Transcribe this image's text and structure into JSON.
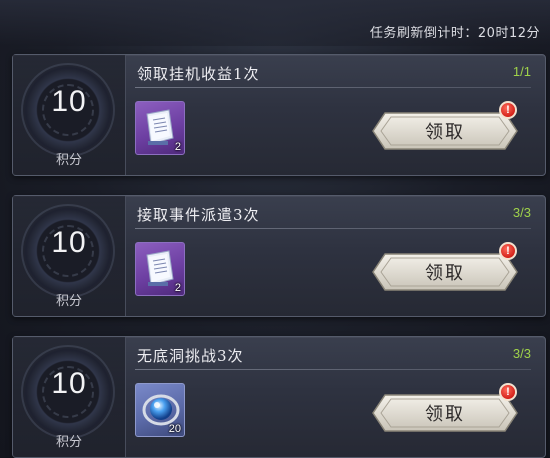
{
  "header": {
    "refresh_timer": "任务刷新倒计时：20时12分"
  },
  "tasks": [
    {
      "points": "10",
      "points_label": "积分",
      "title": "领取挂机收益1次",
      "progress": "1/1",
      "progress_color": "#9fd24a",
      "reward": {
        "icon": "scroll-book-icon",
        "count": "2",
        "rarity_color": "#7a4cb0"
      },
      "claim_label": "领取",
      "has_alert": true
    },
    {
      "points": "10",
      "points_label": "积分",
      "title": "接取事件派遣3次",
      "progress": "3/3",
      "progress_color": "#9fd24a",
      "reward": {
        "icon": "scroll-book-icon",
        "count": "2",
        "rarity_color": "#7a4cb0"
      },
      "claim_label": "领取",
      "has_alert": true
    },
    {
      "points": "10",
      "points_label": "积分",
      "title": "无底洞挑战3次",
      "progress": "3/3",
      "progress_color": "#9fd24a",
      "reward": {
        "icon": "blue-orb-icon",
        "count": "20",
        "rarity_color": "#5b6aa8"
      },
      "claim_label": "领取",
      "has_alert": true
    }
  ],
  "alert_symbol": "!"
}
